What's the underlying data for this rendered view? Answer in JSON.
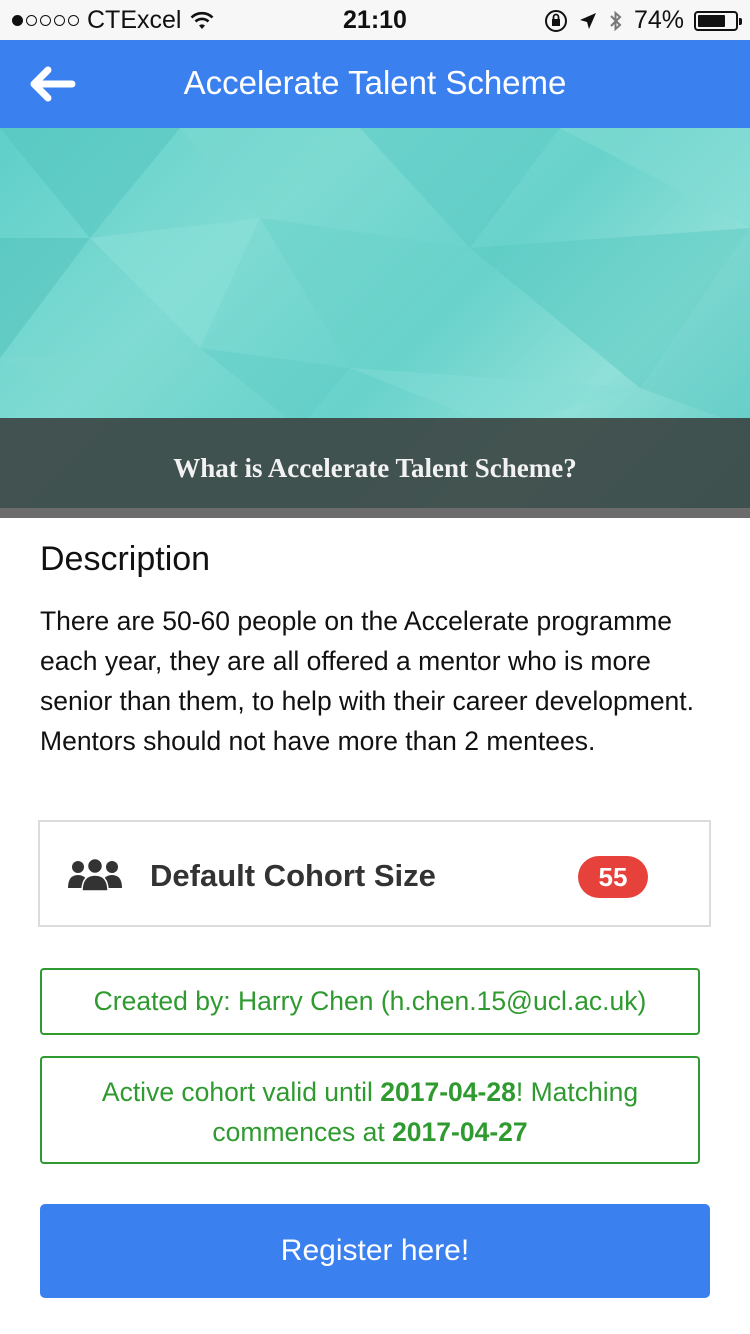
{
  "status_bar": {
    "carrier": "CTExcel",
    "time": "21:10",
    "battery": "74%",
    "battery_level": 0.74,
    "icons": [
      "signal-dots-icon",
      "wifi-icon",
      "orientation-lock-icon",
      "location-arrow-icon",
      "bluetooth-icon",
      "battery-icon"
    ]
  },
  "nav": {
    "title": "Accelerate Talent Scheme",
    "back_icon": "back-arrow-icon"
  },
  "banner": {
    "caption": "What is Accelerate Talent Scheme?"
  },
  "description": {
    "heading": "Description",
    "text": "There are 50-60 people on the Accelerate programme each year, they are all offered a mentor who is more senior than them, to help with their career development. Mentors should not have more than 2 mentees."
  },
  "cohort": {
    "icon": "people-group-icon",
    "label": "Default Cohort Size",
    "size": "55"
  },
  "info": {
    "created_by": "Created by: Harry Chen (h.chen.15@ucl.ac.uk)",
    "valid_prefix": "Active cohort valid until ",
    "valid_date": "2017-04-28",
    "matching_text": "! Matching commences at ",
    "matching_date": "2017-04-27"
  },
  "actions": {
    "register_label": "Register here!"
  },
  "colors": {
    "primary": "#3b80ef",
    "success": "#2f9a2f",
    "badge": "#e7413c"
  }
}
